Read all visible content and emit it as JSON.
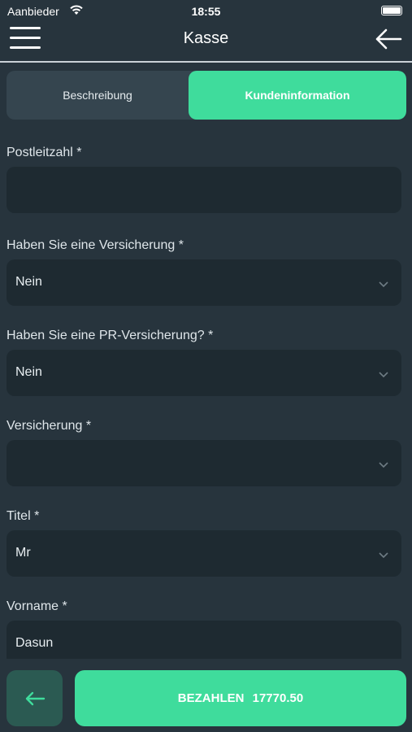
{
  "status_bar": {
    "carrier": "Aanbieder",
    "time": "18:55"
  },
  "header": {
    "title": "Kasse",
    "menu_icon": "hamburger-menu-icon",
    "back_icon": "arrow-left-icon"
  },
  "tabs": [
    {
      "label": "Beschreibung",
      "active": false
    },
    {
      "label": "Kundeninformation",
      "active": true
    }
  ],
  "form": {
    "fields": [
      {
        "label": "Postleitzahl *",
        "value": "",
        "type": "text"
      },
      {
        "label": "Haben Sie eine Versicherung *",
        "value": "Nein",
        "type": "select"
      },
      {
        "label": "Haben Sie eine PR-Versicherung? *",
        "value": "Nein",
        "type": "select"
      },
      {
        "label": "Versicherung *",
        "value": "",
        "type": "select"
      },
      {
        "label": "Titel *",
        "value": "Mr",
        "type": "select"
      },
      {
        "label": "Vorname *",
        "value": "Dasun",
        "type": "text"
      }
    ]
  },
  "footer": {
    "back_icon": "arrow-left-icon",
    "pay_label": "BEZAHLEN",
    "pay_amount": "17770.50"
  },
  "colors": {
    "background": "#27343d",
    "field_background": "#1e2a31",
    "accent": "#3fdc9c",
    "back_button_bg": "#2b5a52"
  }
}
